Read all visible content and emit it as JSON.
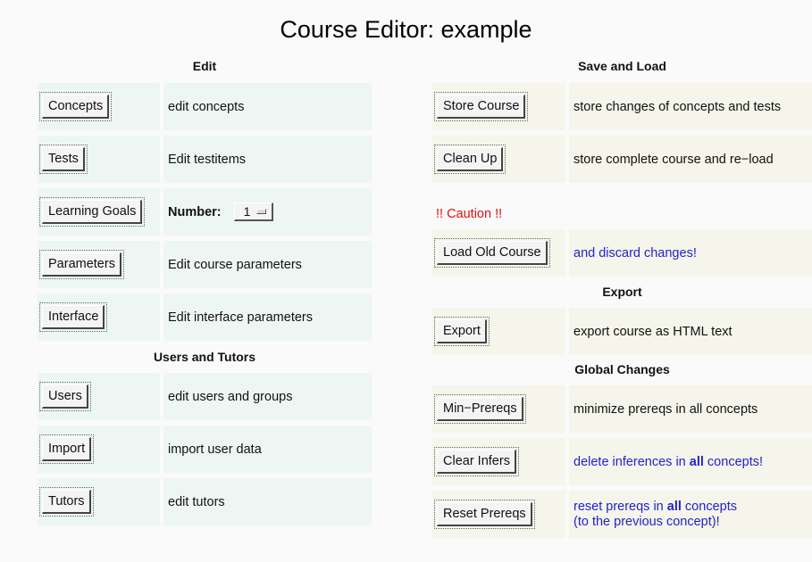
{
  "page_title": "Course Editor: example",
  "edit": {
    "title": "Edit",
    "rows": [
      {
        "button": "Concepts",
        "desc": "edit concepts"
      },
      {
        "button": "Tests",
        "desc": "Edit testitems"
      },
      {
        "button": "Learning Goals",
        "number_label": "Number:",
        "number_value": "1"
      },
      {
        "button": "Parameters",
        "desc": "Edit course parameters"
      },
      {
        "button": "Interface",
        "desc": "Edit interface parameters"
      }
    ]
  },
  "users": {
    "title": "Users and Tutors",
    "rows": [
      {
        "button": "Users",
        "desc": "edit users and groups"
      },
      {
        "button": "Import",
        "desc": "import user data"
      },
      {
        "button": "Tutors",
        "desc": "edit tutors"
      }
    ]
  },
  "save_load": {
    "title": "Save and Load",
    "rows": [
      {
        "button": "Store Course",
        "desc": "store changes of concepts and tests"
      },
      {
        "button": "Clean Up",
        "desc": "store complete course and re−load"
      }
    ],
    "caution": "!! Caution !!",
    "load_old": {
      "button": "Load Old Course",
      "desc": "and discard changes!"
    }
  },
  "export": {
    "title": "Export",
    "button": "Export",
    "desc": "export course as HTML text"
  },
  "global": {
    "title": "Global Changes",
    "min_prereqs": {
      "button": "Min−Prereqs",
      "desc": "minimize prereqs in all concepts"
    },
    "clear_infers": {
      "button": "Clear Infers",
      "desc_pre": "delete inferences in ",
      "desc_bold": "all",
      "desc_post": " concepts!"
    },
    "reset_prereqs": {
      "button": "Reset Prereqs",
      "desc_line1_pre": "reset prereqs in ",
      "desc_line1_bold": "all",
      "desc_line1_post": " concepts",
      "desc_line2": "(to the previous concept)!"
    }
  },
  "colors": {
    "left_cell_bg": "#eef6f4",
    "right_cell_bg": "#f5f5ec",
    "link_blue": "#2222cc",
    "caution_red": "#dd1111"
  }
}
